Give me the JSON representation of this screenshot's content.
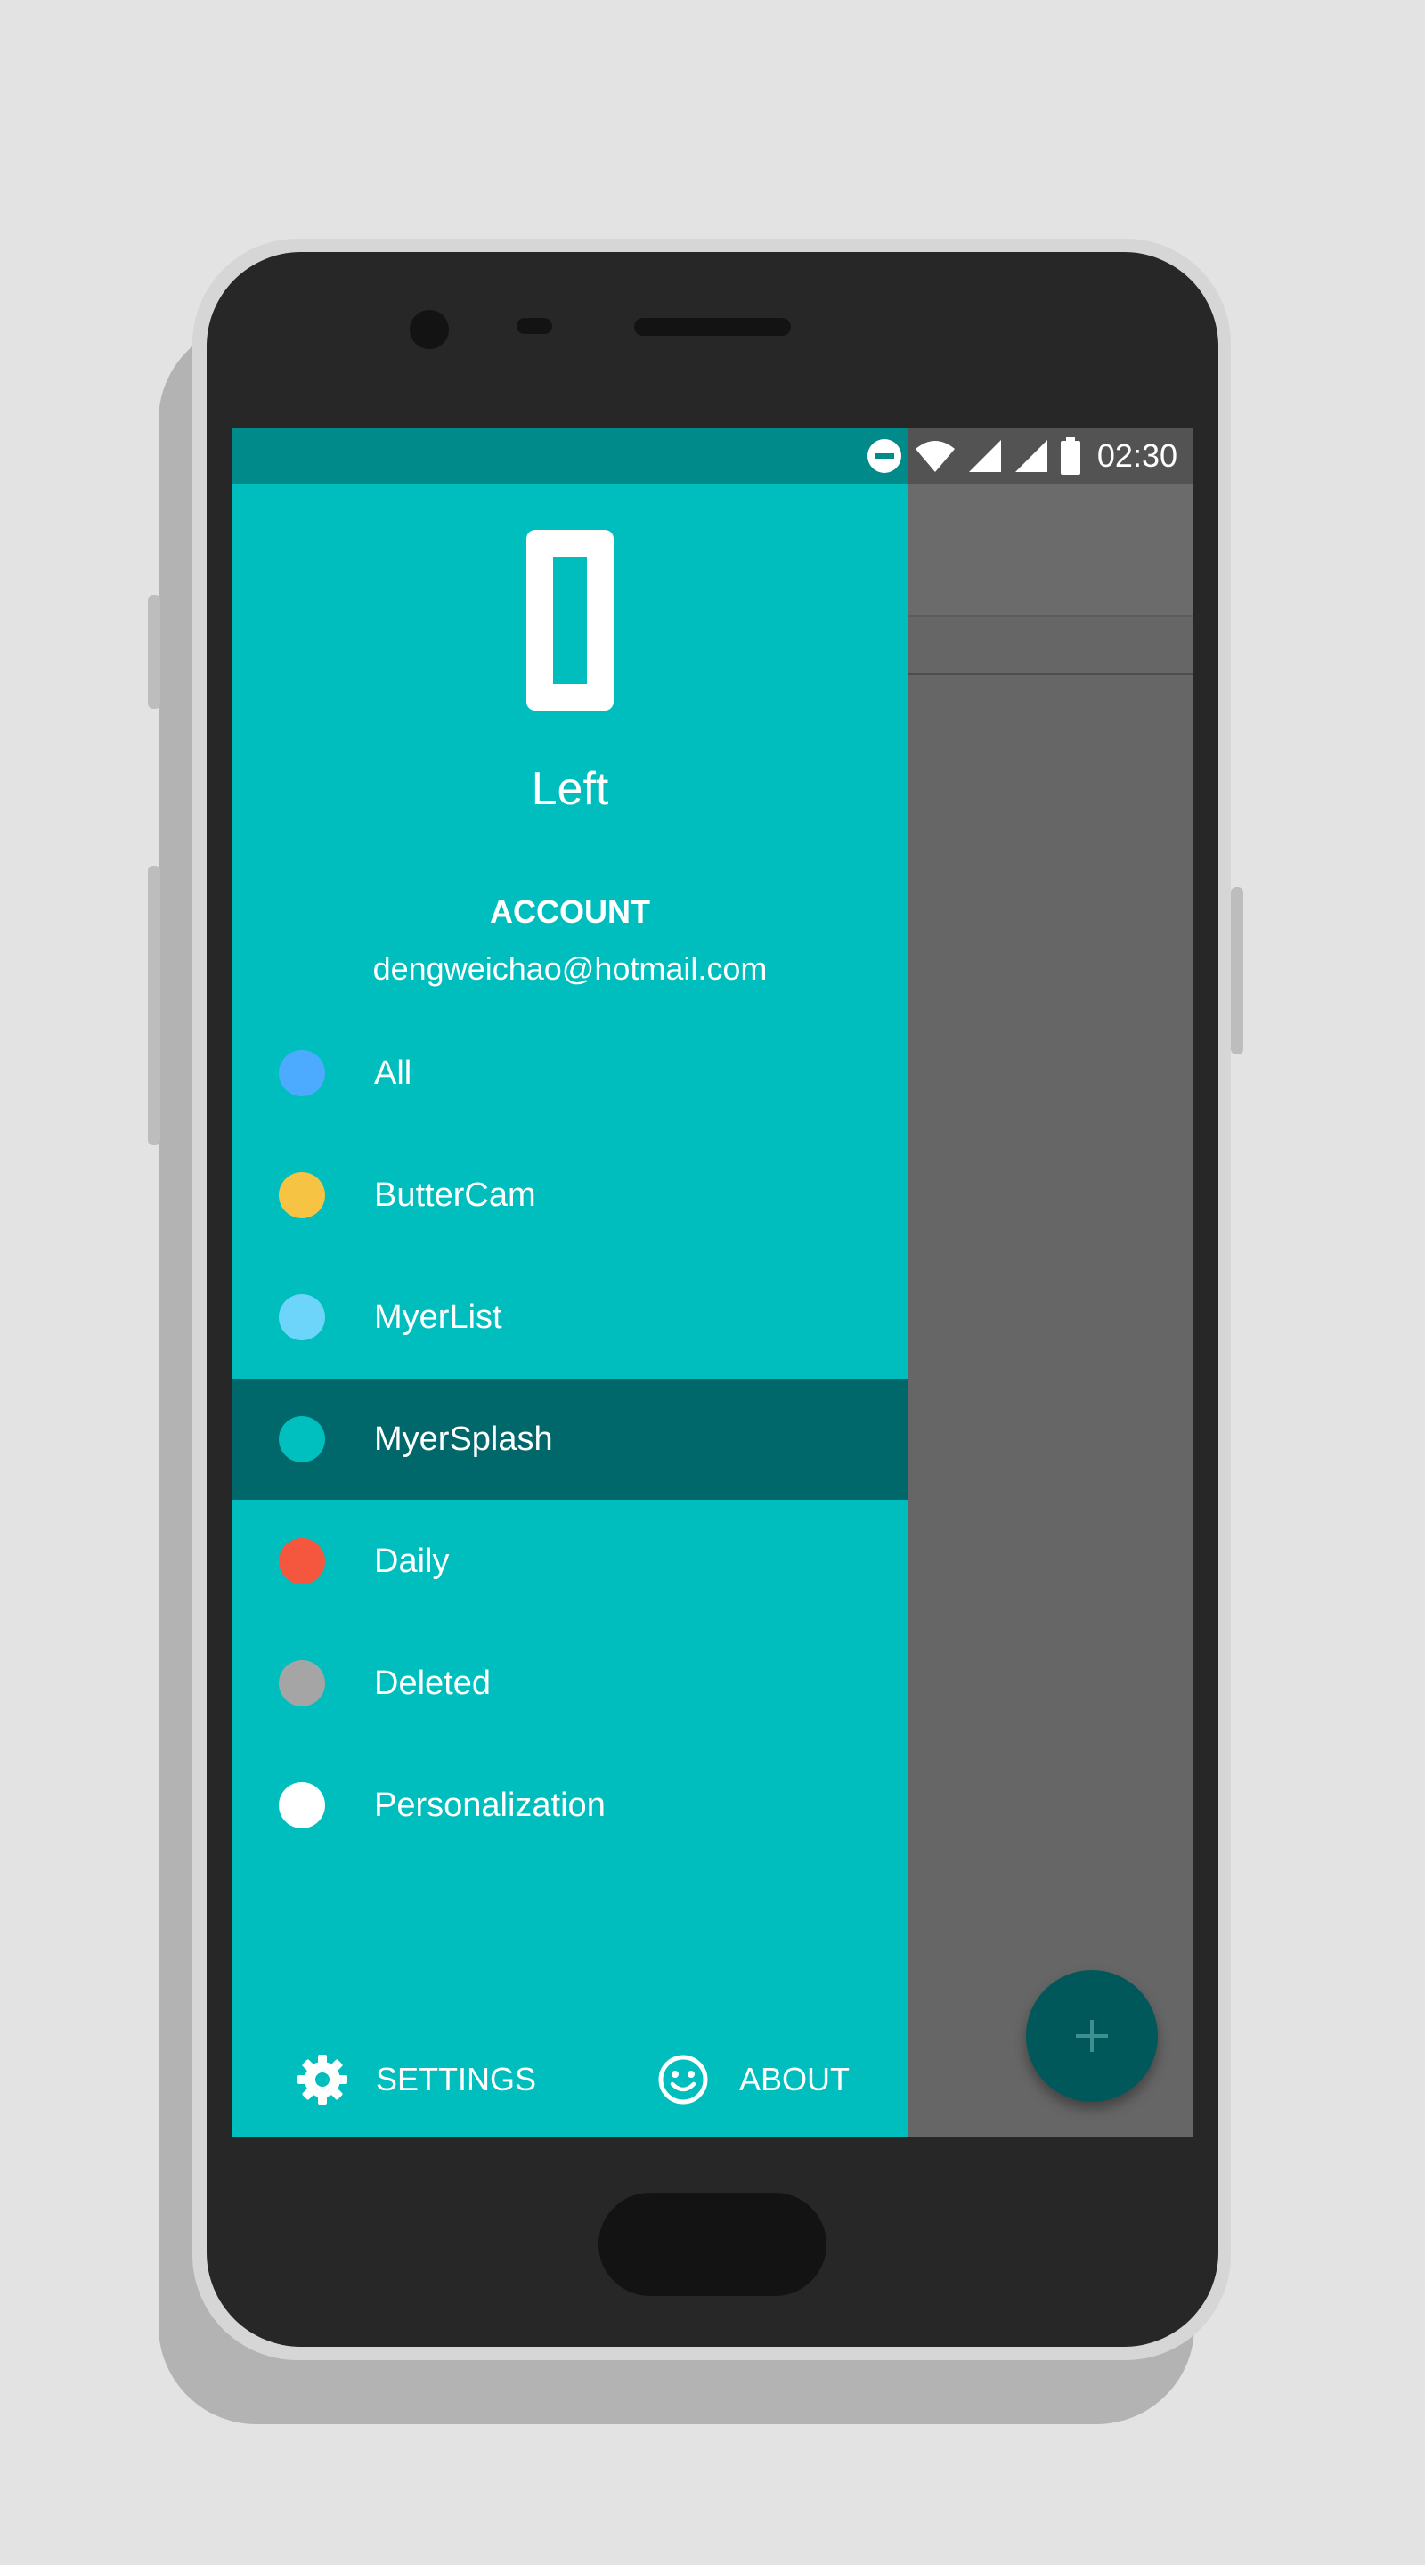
{
  "status_bar": {
    "time": "02:30"
  },
  "drawer": {
    "title": "Left",
    "account_label": "ACCOUNT",
    "account_email": "dengweichao@hotmail.com",
    "items": [
      {
        "label": "All",
        "color": "#4dabff"
      },
      {
        "label": "ButterCam",
        "color": "#f6c343"
      },
      {
        "label": "MyerList",
        "color": "#6dd5fa"
      },
      {
        "label": "MyerSplash",
        "color": "#00bfbf",
        "selected": true
      },
      {
        "label": "Daily",
        "color": "#f4573e"
      },
      {
        "label": "Deleted",
        "color": "#a5a5a5"
      },
      {
        "label": "Personalization",
        "color": "#ffffff"
      }
    ],
    "footer": {
      "settings_label": "SETTINGS",
      "about_label": "ABOUT"
    }
  },
  "fab": {
    "icon": "plus-icon"
  },
  "colors": {
    "drawer_bg": "#00bdbe",
    "selected_bg": "#00676a",
    "status_bg": "#008b8a",
    "fab_bg": "#00585a"
  }
}
